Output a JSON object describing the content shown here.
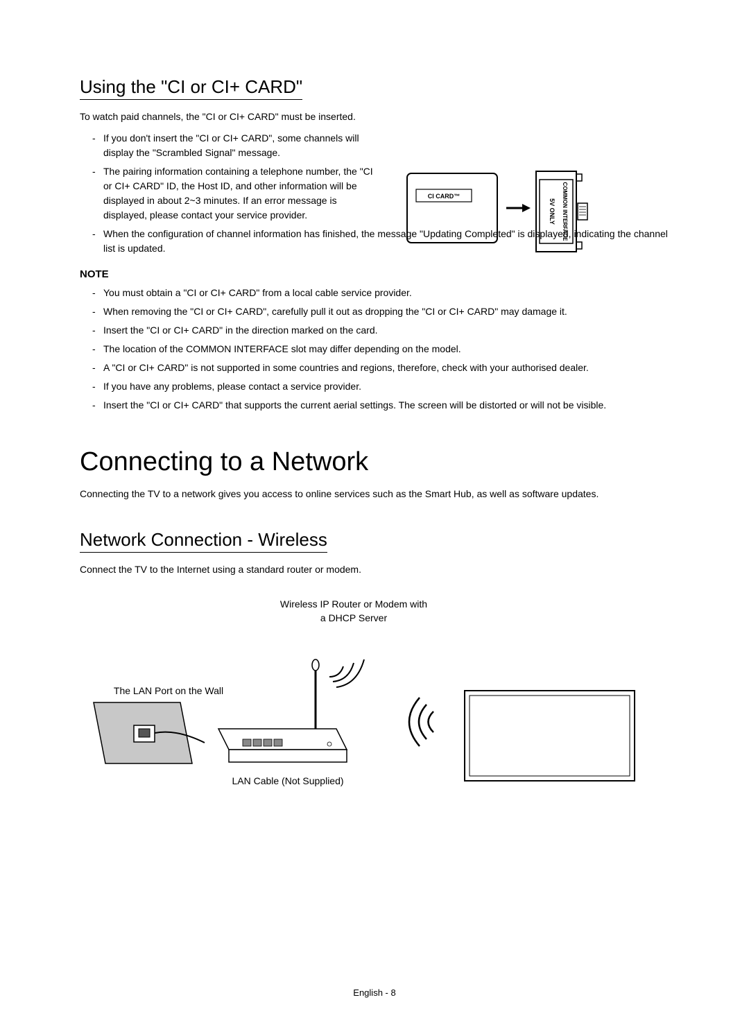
{
  "section1": {
    "title": "Using the \"CI or CI+ CARD\"",
    "intro": "To watch paid channels, the \"CI or CI+ CARD\" must be inserted.",
    "bullets": [
      "If you don't insert the \"CI or CI+ CARD\", some channels will display the \"Scrambled Signal\" message.",
      "The pairing information containing a telephone number, the \"CI or CI+ CARD\" ID, the Host ID, and other information will be displayed in about 2~3 minutes. If an error message is displayed, please contact your service provider.",
      "When the configuration of channel information has finished, the message \"Updating Completed\" is displayed, indicating the channel list is updated."
    ],
    "note_heading": "NOTE",
    "note_bullets": [
      "You must obtain a \"CI or CI+ CARD\" from a local cable service provider.",
      "When removing the \"CI or CI+ CARD\", carefully pull it out as dropping the \"CI or CI+ CARD\" may damage it.",
      "Insert the \"CI or CI+ CARD\" in the direction marked on the card.",
      "The location of the COMMON INTERFACE slot may differ depending on the model.",
      "A \"CI or CI+ CARD\" is not supported in some countries and regions, therefore, check with your authorised dealer.",
      "If you have any problems, please contact a service provider.",
      "Insert the \"CI or CI+ CARD\" that supports the current aerial settings. The screen will be distorted or will not be visible."
    ],
    "diagram": {
      "card_label": "CI CARD™",
      "slot_label_1": "5V ONLY",
      "slot_label_2": "COMMON INTERFACE"
    }
  },
  "section2": {
    "title": "Connecting to a Network",
    "intro": "Connecting the TV to a network gives you access to online services such as the Smart Hub, as well as software updates."
  },
  "section3": {
    "title": "Network Connection - Wireless",
    "intro": "Connect the TV to the Internet using a standard router or modem.",
    "diagram": {
      "router_label_line1": "Wireless IP Router or Modem with",
      "router_label_line2": "a DHCP Server",
      "wall_label": "The LAN Port on the Wall",
      "cable_label": "LAN Cable (Not Supplied)"
    }
  },
  "footer": {
    "page": "English - 8"
  }
}
